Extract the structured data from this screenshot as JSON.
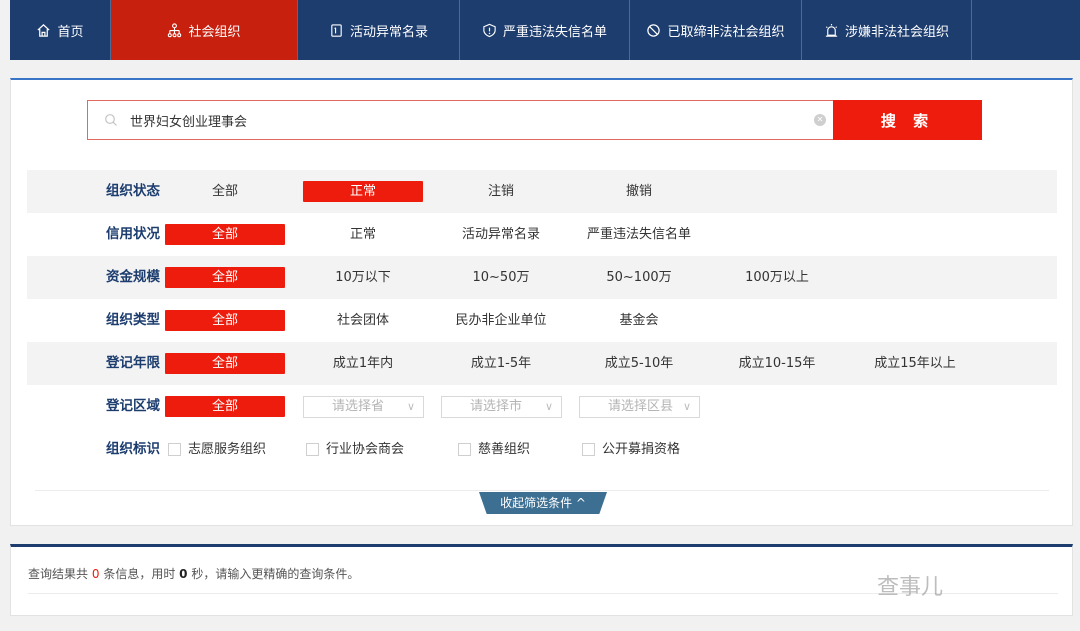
{
  "nav": {
    "items": [
      {
        "label": "首页",
        "icon": "home-icon"
      },
      {
        "label": "社会组织",
        "icon": "org-tree-icon",
        "active": true
      },
      {
        "label": "活动异常名录",
        "icon": "doc-list-icon"
      },
      {
        "label": "严重违法失信名单",
        "icon": "shield-warning-icon"
      },
      {
        "label": "已取缔非法社会组织",
        "icon": "ban-icon"
      },
      {
        "label": "涉嫌非法社会组织",
        "icon": "alarm-bell-icon"
      }
    ]
  },
  "search": {
    "value": "世界妇女创业理事会",
    "button_label": "搜 索"
  },
  "filters": {
    "status": {
      "label": "组织状态",
      "options": [
        "全部",
        "正常",
        "注销",
        "撤销"
      ]
    },
    "credit": {
      "label": "信用状况",
      "options": [
        "全部",
        "正常",
        "活动异常名录",
        "严重违法失信名单"
      ]
    },
    "capital": {
      "label": "资金规模",
      "options": [
        "全部",
        "10万以下",
        "10~50万",
        "50~100万",
        "100万以上"
      ]
    },
    "type": {
      "label": "组织类型",
      "options": [
        "全部",
        "社会团体",
        "民办非企业单位",
        "基金会"
      ]
    },
    "years": {
      "label": "登记年限",
      "options": [
        "全部",
        "成立1年内",
        "成立1-5年",
        "成立5-10年",
        "成立10-15年",
        "成立15年以上"
      ]
    },
    "region": {
      "label": "登记区域",
      "all": "全部",
      "province": "请选择省",
      "city": "请选择市",
      "district": "请选择区县"
    },
    "marks": {
      "label": "组织标识",
      "options": [
        "志愿服务组织",
        "行业协会商会",
        "慈善组织",
        "公开募捐资格"
      ]
    }
  },
  "collapse_label": "收起筛选条件 ^",
  "results": {
    "prefix": "查询结果共",
    "count": "0",
    "mid1": "条信息，用时",
    "time": "0",
    "mid2": "秒，请输入更精确的查询条件。"
  },
  "watermark": "查事儿"
}
